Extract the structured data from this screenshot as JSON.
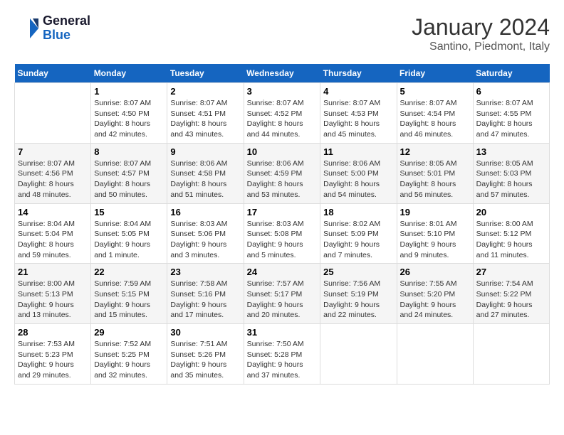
{
  "header": {
    "logo_general": "General",
    "logo_blue": "Blue",
    "month_title": "January 2024",
    "location": "Santino, Piedmont, Italy"
  },
  "days_of_week": [
    "Sunday",
    "Monday",
    "Tuesday",
    "Wednesday",
    "Thursday",
    "Friday",
    "Saturday"
  ],
  "weeks": [
    [
      {
        "num": "",
        "info": ""
      },
      {
        "num": "1",
        "info": "Sunrise: 8:07 AM\nSunset: 4:50 PM\nDaylight: 8 hours\nand 42 minutes."
      },
      {
        "num": "2",
        "info": "Sunrise: 8:07 AM\nSunset: 4:51 PM\nDaylight: 8 hours\nand 43 minutes."
      },
      {
        "num": "3",
        "info": "Sunrise: 8:07 AM\nSunset: 4:52 PM\nDaylight: 8 hours\nand 44 minutes."
      },
      {
        "num": "4",
        "info": "Sunrise: 8:07 AM\nSunset: 4:53 PM\nDaylight: 8 hours\nand 45 minutes."
      },
      {
        "num": "5",
        "info": "Sunrise: 8:07 AM\nSunset: 4:54 PM\nDaylight: 8 hours\nand 46 minutes."
      },
      {
        "num": "6",
        "info": "Sunrise: 8:07 AM\nSunset: 4:55 PM\nDaylight: 8 hours\nand 47 minutes."
      }
    ],
    [
      {
        "num": "7",
        "info": "Sunrise: 8:07 AM\nSunset: 4:56 PM\nDaylight: 8 hours\nand 48 minutes."
      },
      {
        "num": "8",
        "info": "Sunrise: 8:07 AM\nSunset: 4:57 PM\nDaylight: 8 hours\nand 50 minutes."
      },
      {
        "num": "9",
        "info": "Sunrise: 8:06 AM\nSunset: 4:58 PM\nDaylight: 8 hours\nand 51 minutes."
      },
      {
        "num": "10",
        "info": "Sunrise: 8:06 AM\nSunset: 4:59 PM\nDaylight: 8 hours\nand 53 minutes."
      },
      {
        "num": "11",
        "info": "Sunrise: 8:06 AM\nSunset: 5:00 PM\nDaylight: 8 hours\nand 54 minutes."
      },
      {
        "num": "12",
        "info": "Sunrise: 8:05 AM\nSunset: 5:01 PM\nDaylight: 8 hours\nand 56 minutes."
      },
      {
        "num": "13",
        "info": "Sunrise: 8:05 AM\nSunset: 5:03 PM\nDaylight: 8 hours\nand 57 minutes."
      }
    ],
    [
      {
        "num": "14",
        "info": "Sunrise: 8:04 AM\nSunset: 5:04 PM\nDaylight: 8 hours\nand 59 minutes."
      },
      {
        "num": "15",
        "info": "Sunrise: 8:04 AM\nSunset: 5:05 PM\nDaylight: 9 hours\nand 1 minute."
      },
      {
        "num": "16",
        "info": "Sunrise: 8:03 AM\nSunset: 5:06 PM\nDaylight: 9 hours\nand 3 minutes."
      },
      {
        "num": "17",
        "info": "Sunrise: 8:03 AM\nSunset: 5:08 PM\nDaylight: 9 hours\nand 5 minutes."
      },
      {
        "num": "18",
        "info": "Sunrise: 8:02 AM\nSunset: 5:09 PM\nDaylight: 9 hours\nand 7 minutes."
      },
      {
        "num": "19",
        "info": "Sunrise: 8:01 AM\nSunset: 5:10 PM\nDaylight: 9 hours\nand 9 minutes."
      },
      {
        "num": "20",
        "info": "Sunrise: 8:00 AM\nSunset: 5:12 PM\nDaylight: 9 hours\nand 11 minutes."
      }
    ],
    [
      {
        "num": "21",
        "info": "Sunrise: 8:00 AM\nSunset: 5:13 PM\nDaylight: 9 hours\nand 13 minutes."
      },
      {
        "num": "22",
        "info": "Sunrise: 7:59 AM\nSunset: 5:15 PM\nDaylight: 9 hours\nand 15 minutes."
      },
      {
        "num": "23",
        "info": "Sunrise: 7:58 AM\nSunset: 5:16 PM\nDaylight: 9 hours\nand 17 minutes."
      },
      {
        "num": "24",
        "info": "Sunrise: 7:57 AM\nSunset: 5:17 PM\nDaylight: 9 hours\nand 20 minutes."
      },
      {
        "num": "25",
        "info": "Sunrise: 7:56 AM\nSunset: 5:19 PM\nDaylight: 9 hours\nand 22 minutes."
      },
      {
        "num": "26",
        "info": "Sunrise: 7:55 AM\nSunset: 5:20 PM\nDaylight: 9 hours\nand 24 minutes."
      },
      {
        "num": "27",
        "info": "Sunrise: 7:54 AM\nSunset: 5:22 PM\nDaylight: 9 hours\nand 27 minutes."
      }
    ],
    [
      {
        "num": "28",
        "info": "Sunrise: 7:53 AM\nSunset: 5:23 PM\nDaylight: 9 hours\nand 29 minutes."
      },
      {
        "num": "29",
        "info": "Sunrise: 7:52 AM\nSunset: 5:25 PM\nDaylight: 9 hours\nand 32 minutes."
      },
      {
        "num": "30",
        "info": "Sunrise: 7:51 AM\nSunset: 5:26 PM\nDaylight: 9 hours\nand 35 minutes."
      },
      {
        "num": "31",
        "info": "Sunrise: 7:50 AM\nSunset: 5:28 PM\nDaylight: 9 hours\nand 37 minutes."
      },
      {
        "num": "",
        "info": ""
      },
      {
        "num": "",
        "info": ""
      },
      {
        "num": "",
        "info": ""
      }
    ]
  ]
}
